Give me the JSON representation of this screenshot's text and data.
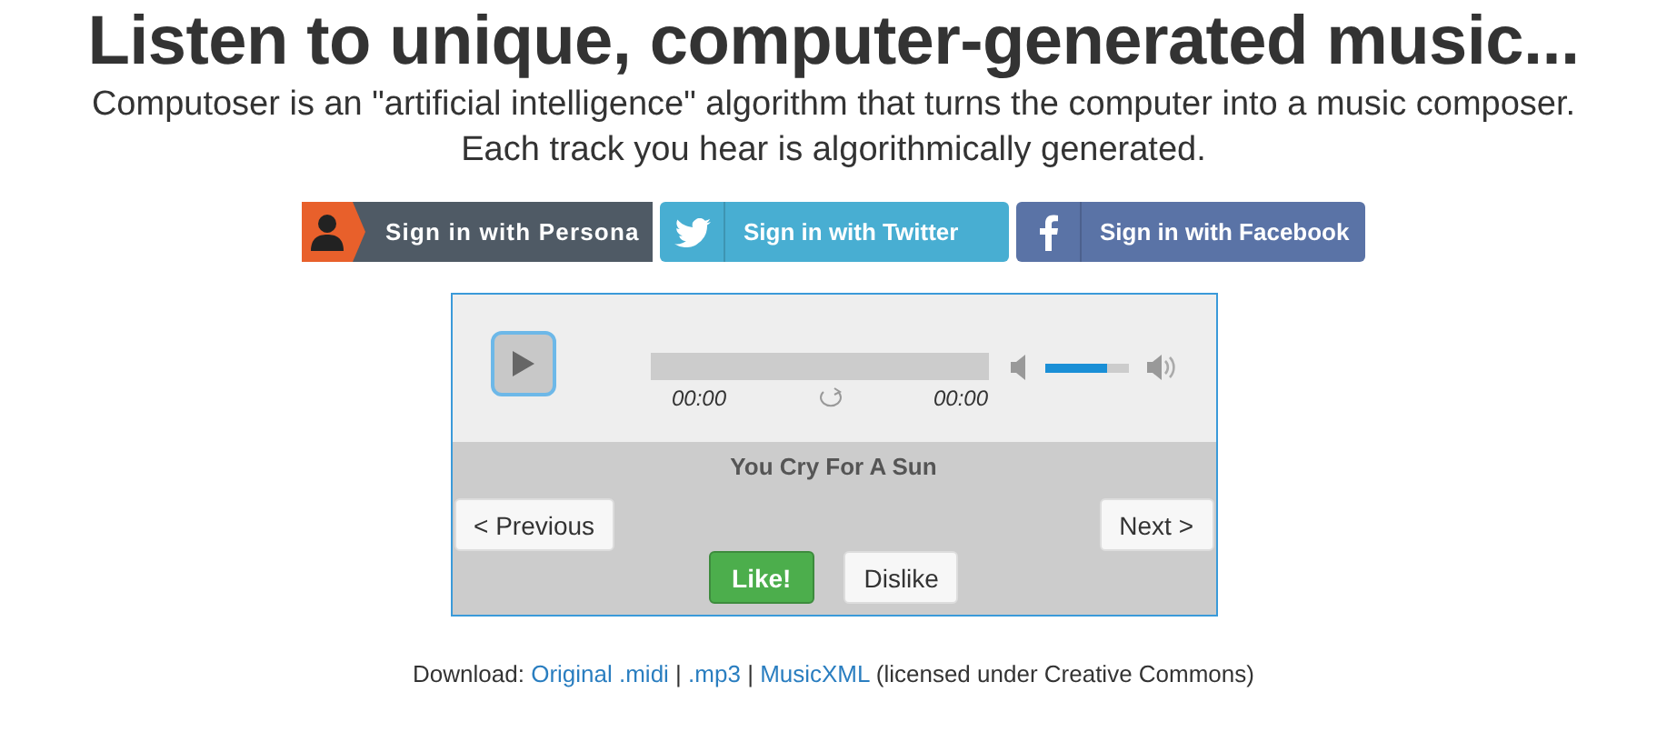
{
  "heading": "Listen to unique, computer-generated music...",
  "intro": [
    "Computoser is an \"artificial intelligence\" algorithm that turns the computer into a music composer.",
    "Each track you hear is algorithmically generated."
  ],
  "sign_in": [
    {
      "kind": "persona",
      "label": "Sign in with Persona"
    },
    {
      "kind": "twitter",
      "label": "Sign in with Twitter"
    },
    {
      "kind": "facebook",
      "label": "Sign in with Facebook"
    }
  ],
  "player": {
    "elapsed": "00:00",
    "duration": "00:00",
    "volume": {
      "level": 0.76
    },
    "track_title": "You Cry For A Sun",
    "previous": "< Previous",
    "next": "Next >",
    "like": "Like!",
    "dislike": "Dislike"
  },
  "download": {
    "label": "Download:",
    "links": [
      "Original .midi",
      ".mp3",
      "MusicXML"
    ],
    "separator": "|",
    "note": "(licensed under Creative Commons)"
  }
}
